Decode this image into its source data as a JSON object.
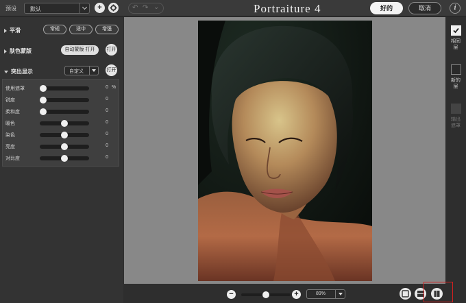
{
  "toolbar": {
    "preset_label": "预设",
    "preset_value": "默认",
    "add_icon": "plus-icon",
    "settings_icon": "gear-icon",
    "undo_icon": "undo-icon",
    "redo_icon": "redo-icon",
    "app_title": "Portraiture 4",
    "ok_label": "好的",
    "cancel_label": "取消",
    "info_label": "i"
  },
  "left_panel": {
    "smoothing": {
      "title": "平滑",
      "buttons": [
        "常规",
        "适中",
        "增强"
      ]
    },
    "skin_mask": {
      "title": "肤色蒙版",
      "auto_label": "自动蒙版 打开",
      "toggle_label": "打开"
    },
    "enhancements": {
      "title": "突出显示",
      "select_value": "自定义",
      "toggle_label": "打开",
      "sliders": [
        {
          "label": "使用遮罩",
          "value": 0,
          "unit": "%",
          "level": 0.0
        },
        {
          "label": "锐度",
          "value": 0,
          "unit": "",
          "level": 0.0
        },
        {
          "label": "柔和度",
          "value": 0,
          "unit": "",
          "level": 0.0
        },
        {
          "label": "暖色",
          "value": 0,
          "unit": "",
          "level": 0.5
        },
        {
          "label": "染色",
          "value": 0,
          "unit": "",
          "level": 0.5
        },
        {
          "label": "亮度",
          "value": 0,
          "unit": "",
          "level": 0.5
        },
        {
          "label": "对比度",
          "value": 0,
          "unit": "",
          "level": 0.5
        }
      ]
    }
  },
  "right_panel": {
    "items": [
      {
        "label": "相同\n层",
        "checked": true
      },
      {
        "label": "新的\n层",
        "checked": false
      },
      {
        "label": "输出\n遮罩",
        "checked": false
      }
    ]
  },
  "bottom_bar": {
    "zoom_out_label": "−",
    "zoom_in_label": "+",
    "zoom_level": 0.5,
    "zoom_value": "89%",
    "view_modes": [
      "single-view-icon",
      "split-horizontal-icon",
      "split-vertical-icon"
    ]
  }
}
